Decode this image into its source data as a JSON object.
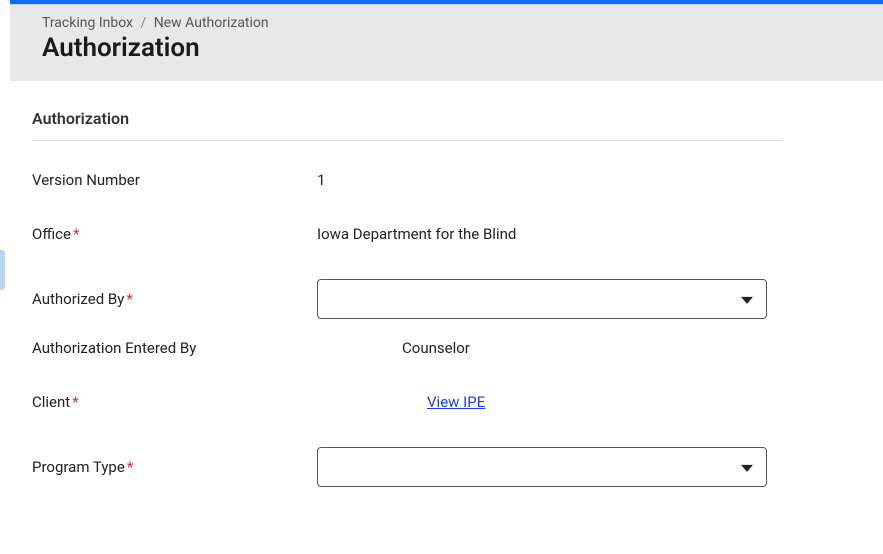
{
  "breadcrumb": {
    "item1": "Tracking Inbox",
    "item2": "New Authorization"
  },
  "page_title": "Authorization",
  "section_title": "Authorization",
  "fields": {
    "version_number": {
      "label": "Version Number",
      "value": "1"
    },
    "office": {
      "label": "Office",
      "value": "Iowa Department for the Blind"
    },
    "authorized_by": {
      "label": "Authorized By",
      "value": ""
    },
    "authorization_entered_by": {
      "label": "Authorization Entered By",
      "value": "Counselor"
    },
    "client": {
      "label": "Client",
      "link_text": "View IPE"
    },
    "program_type": {
      "label": "Program Type",
      "value": ""
    }
  }
}
